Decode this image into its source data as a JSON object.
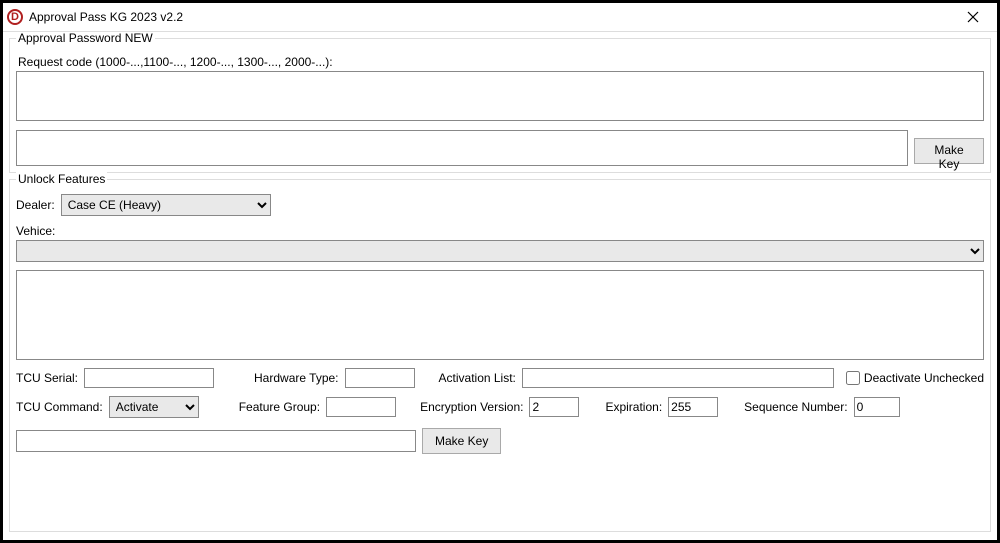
{
  "window": {
    "title": "Approval Pass KG 2023 v2.2",
    "icon_letter": "D"
  },
  "group1": {
    "legend": "Approval Password NEW",
    "request_label": "Request code (1000-...,1100-..., 1200-..., 1300-..., 2000-...):",
    "request_value": "",
    "key_value": "",
    "make_key_label": "Make Key"
  },
  "group2": {
    "legend": "Unlock Features",
    "dealer_label": "Dealer:",
    "dealer_selected": "Case CE (Heavy)",
    "vehicle_label": "Vehice:",
    "vehicle_selected": "",
    "output_value": "",
    "tcu_serial_label": "TCU Serial:",
    "tcu_serial_value": "",
    "hardware_type_label": "Hardware Type:",
    "hardware_type_value": "",
    "activation_list_label": "Activation List:",
    "activation_list_value": "",
    "deactivate_label": "Deactivate Unchecked",
    "deactivate_checked": false,
    "tcu_command_label": "TCU Command:",
    "tcu_command_selected": "Activate",
    "feature_group_label": "Feature Group:",
    "feature_group_value": "",
    "encryption_version_label": "Encryption Version:",
    "encryption_version_value": "2",
    "expiration_label": "Expiration:",
    "expiration_value": "255",
    "sequence_number_label": "Sequence Number:",
    "sequence_number_value": "0",
    "out_key_value": "",
    "make_key_label": "Make Key"
  }
}
